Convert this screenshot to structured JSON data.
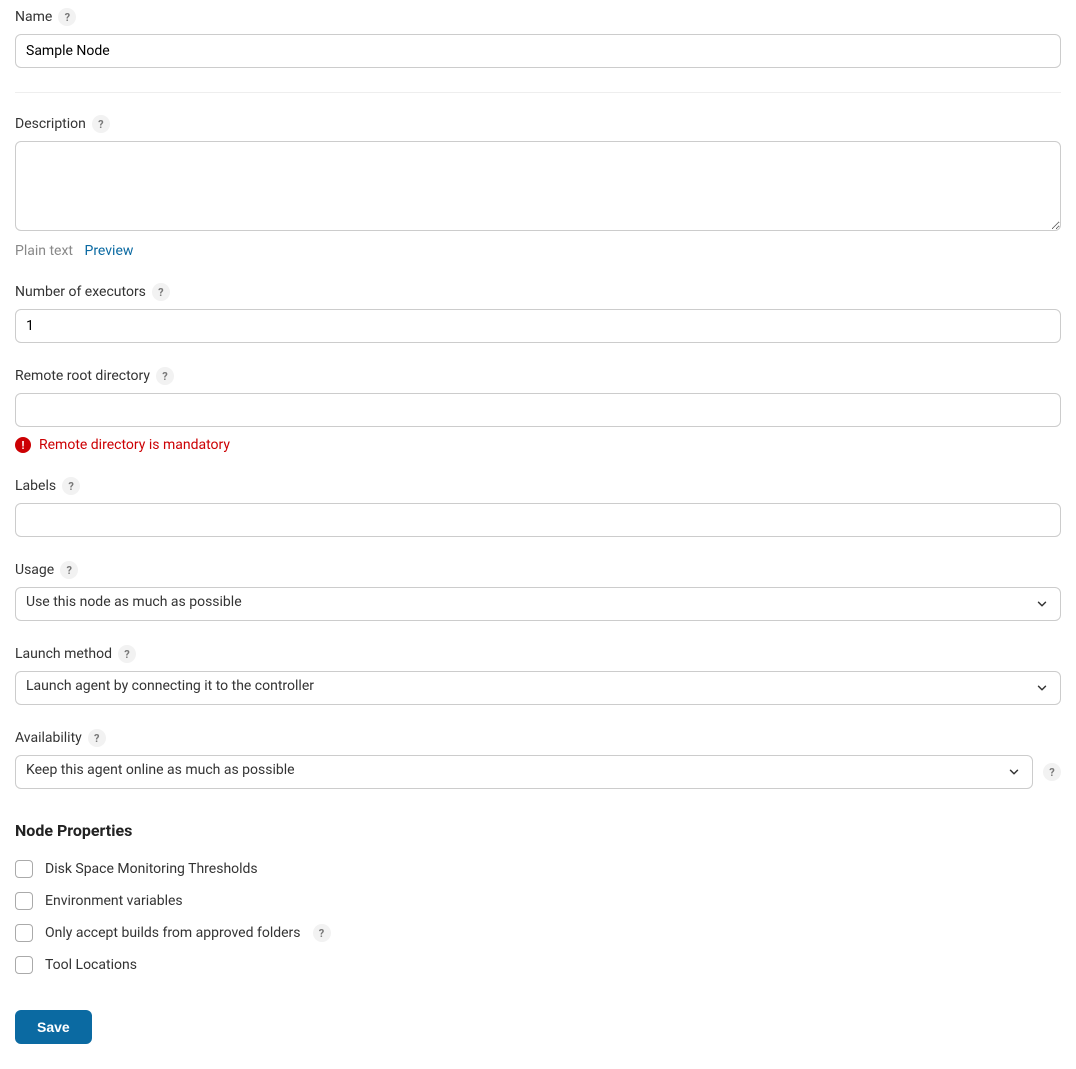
{
  "fields": {
    "name": {
      "label": "Name",
      "value": "Sample Node"
    },
    "description": {
      "label": "Description",
      "value": "",
      "plain_text_label": "Plain text",
      "preview_label": "Preview"
    },
    "executors": {
      "label": "Number of executors",
      "value": "1"
    },
    "remote_root": {
      "label": "Remote root directory",
      "value": "",
      "error": "Remote directory is mandatory"
    },
    "labels": {
      "label": "Labels",
      "value": ""
    },
    "usage": {
      "label": "Usage",
      "value": "Use this node as much as possible"
    },
    "launch_method": {
      "label": "Launch method",
      "value": "Launch agent by connecting it to the controller"
    },
    "availability": {
      "label": "Availability",
      "value": "Keep this agent online as much as possible"
    }
  },
  "node_properties": {
    "heading": "Node Properties",
    "items": [
      {
        "label": "Disk Space Monitoring Thresholds",
        "checked": false,
        "help": false
      },
      {
        "label": "Environment variables",
        "checked": false,
        "help": false
      },
      {
        "label": "Only accept builds from approved folders",
        "checked": false,
        "help": true
      },
      {
        "label": "Tool Locations",
        "checked": false,
        "help": false
      }
    ]
  },
  "buttons": {
    "save": "Save"
  },
  "help_glyph": "?"
}
